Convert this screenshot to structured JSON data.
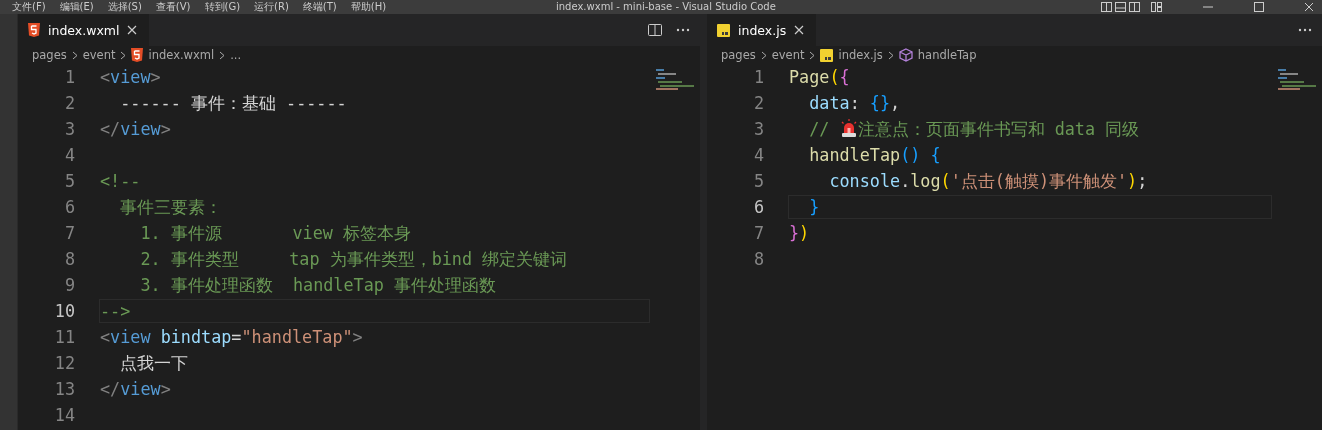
{
  "title_bar": {
    "menu": [
      "文件(F)",
      "编辑(E)",
      "选择(S)",
      "查看(V)",
      "转到(G)",
      "运行(R)",
      "终端(T)",
      "帮助(H)"
    ],
    "title": "index.wxml - mini-base - Visual Studio Code"
  },
  "editors": [
    {
      "tab": {
        "label": "index.wxml",
        "kind": "html"
      },
      "breadcrumb": [
        {
          "label": "pages"
        },
        {
          "label": "event"
        },
        {
          "label": "index.wxml",
          "kind": "html"
        },
        {
          "label": "..."
        }
      ],
      "lines": [
        {
          "number": "1",
          "current": false,
          "tokens": [
            {
              "kind": "punct",
              "text": "<"
            },
            {
              "kind": "tag",
              "text": "view"
            },
            {
              "kind": "punct",
              "text": ">"
            }
          ]
        },
        {
          "number": "2",
          "current": false,
          "tokens": [
            {
              "kind": "text",
              "text": "  ------ 事件：基础 ------"
            }
          ]
        },
        {
          "number": "3",
          "current": false,
          "tokens": [
            {
              "kind": "punct",
              "text": "</"
            },
            {
              "kind": "tag",
              "text": "view"
            },
            {
              "kind": "punct",
              "text": ">"
            }
          ]
        },
        {
          "number": "4",
          "current": false
        },
        {
          "number": "5",
          "current": false,
          "tokens": [
            {
              "kind": "comment",
              "text": "<!--"
            }
          ]
        },
        {
          "number": "6",
          "current": false,
          "tokens": [
            {
              "kind": "comment",
              "text": "  事件三要素："
            }
          ]
        },
        {
          "number": "7",
          "current": false,
          "tokens": [
            {
              "kind": "comment",
              "text": "    1. 事件源       view 标签本身"
            }
          ]
        },
        {
          "number": "8",
          "current": false,
          "tokens": [
            {
              "kind": "comment",
              "text": "    2. 事件类型     tap 为事件类型，bind 绑定关键词"
            }
          ]
        },
        {
          "number": "9",
          "current": false,
          "tokens": [
            {
              "kind": "comment",
              "text": "    3. 事件处理函数  handleTap 事件处理函数"
            }
          ]
        },
        {
          "number": "10",
          "current": true,
          "tokens": [
            {
              "kind": "comment",
              "text": "-->"
            }
          ]
        },
        {
          "number": "11",
          "current": false,
          "tokens": [
            {
              "kind": "punct",
              "text": "<"
            },
            {
              "kind": "tag",
              "text": "view"
            },
            {
              "kind": "attr",
              "text": " bindtap"
            },
            {
              "kind": "text",
              "text": "="
            },
            {
              "kind": "string",
              "text": "\"handleTap\""
            },
            {
              "kind": "punct",
              "text": ">"
            }
          ]
        },
        {
          "number": "12",
          "current": false,
          "tokens": [
            {
              "kind": "text",
              "text": "  点我一下"
            }
          ]
        },
        {
          "number": "13",
          "current": false,
          "tokens": [
            {
              "kind": "punct",
              "text": "</"
            },
            {
              "kind": "tag",
              "text": "view"
            },
            {
              "kind": "punct",
              "text": ">"
            }
          ]
        },
        {
          "number": "14",
          "current": false
        }
      ]
    },
    {
      "tab": {
        "label": "index.js",
        "kind": "js"
      },
      "breadcrumb": [
        {
          "label": "pages"
        },
        {
          "label": "event"
        },
        {
          "label": "index.js",
          "kind": "js"
        },
        {
          "label": "handleTap",
          "kind": "method"
        }
      ],
      "lines": [
        {
          "number": "1",
          "current": false,
          "tokens": [
            {
              "kind": "func",
              "text": "Page"
            },
            {
              "kind": "bracket1",
              "text": "("
            },
            {
              "kind": "bracket2",
              "text": "{"
            }
          ]
        },
        {
          "number": "2",
          "current": false,
          "tokens": [
            {
              "kind": "prop",
              "text": "  data"
            },
            {
              "kind": "text",
              "text": ": "
            },
            {
              "kind": "bracket3",
              "text": "{}"
            },
            {
              "kind": "text",
              "text": ","
            }
          ]
        },
        {
          "number": "3",
          "current": false,
          "tokens": [
            {
              "kind": "comment",
              "text": "  // "
            },
            {
              "kind": "siren"
            },
            {
              "kind": "comment",
              "text": "注意点：页面事件书写和 data 同级"
            }
          ]
        },
        {
          "number": "4",
          "current": false,
          "tokens": [
            {
              "kind": "func",
              "text": "  handleTap"
            },
            {
              "kind": "bracket3",
              "text": "() {"
            }
          ]
        },
        {
          "number": "5",
          "current": false,
          "tokens": [
            {
              "kind": "prop",
              "text": "    console"
            },
            {
              "kind": "text",
              "text": "."
            },
            {
              "kind": "func",
              "text": "log"
            },
            {
              "kind": "bracket1",
              "text": "("
            },
            {
              "kind": "string",
              "text": "'点击(触摸)事件触发'"
            },
            {
              "kind": "bracket1",
              "text": ")"
            },
            {
              "kind": "text",
              "text": ";"
            }
          ]
        },
        {
          "number": "6",
          "current": true,
          "tokens": [
            {
              "kind": "bracket3",
              "text": "  }"
            }
          ]
        },
        {
          "number": "7",
          "current": false,
          "tokens": [
            {
              "kind": "bracket2",
              "text": "}"
            },
            {
              "kind": "bracket1",
              "text": ")"
            }
          ]
        },
        {
          "number": "8",
          "current": false
        }
      ]
    }
  ]
}
